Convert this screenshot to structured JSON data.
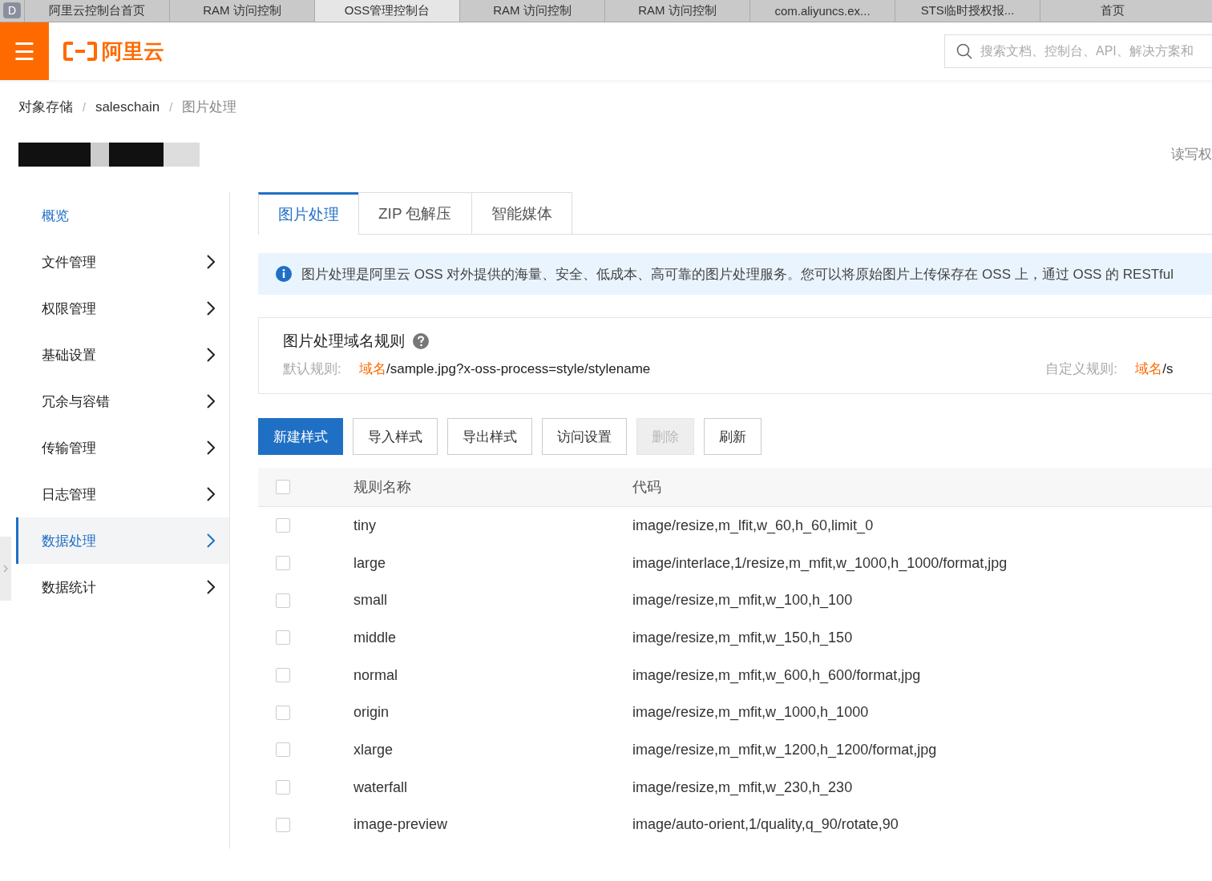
{
  "browser_tabs": [
    {
      "label": "阿里云控制台首页",
      "selected": false
    },
    {
      "label": "RAM 访问控制",
      "selected": false
    },
    {
      "label": "OSS管理控制台",
      "selected": true
    },
    {
      "label": "RAM 访问控制",
      "selected": false
    },
    {
      "label": "RAM 访问控制",
      "selected": false
    },
    {
      "label": "com.aliyuncs.ex...",
      "selected": false
    },
    {
      "label": "STS临时授权报...",
      "selected": false
    },
    {
      "label": "首页",
      "selected": false
    }
  ],
  "browser_badge": "D",
  "header": {
    "menu_icon": "☰",
    "logo_text": "阿里云",
    "search": {
      "placeholder": "搜索文档、控制台、API、解决方案和"
    }
  },
  "breadcrumbs": [
    "对象存储",
    "saleschain",
    "图片处理"
  ],
  "breadcrumb_separator": "/",
  "bucket_meta": "读写权",
  "sidebar": {
    "items": [
      {
        "label": "概览",
        "kind": "link",
        "selected": false
      },
      {
        "label": "文件管理",
        "kind": "group",
        "selected": false
      },
      {
        "label": "权限管理",
        "kind": "group",
        "selected": false
      },
      {
        "label": "基础设置",
        "kind": "group",
        "selected": false
      },
      {
        "label": "冗余与容错",
        "kind": "group",
        "selected": false
      },
      {
        "label": "传输管理",
        "kind": "group",
        "selected": false
      },
      {
        "label": "日志管理",
        "kind": "group",
        "selected": false
      },
      {
        "label": "数据处理",
        "kind": "group",
        "selected": true
      },
      {
        "label": "数据统计",
        "kind": "group",
        "selected": false
      }
    ]
  },
  "tabs": [
    {
      "label": "图片处理",
      "selected": true
    },
    {
      "label": "ZIP 包解压",
      "selected": false
    },
    {
      "label": "智能媒体",
      "selected": false
    }
  ],
  "info": "图片处理是阿里云 OSS 对外提供的海量、安全、低成本、高可靠的图片处理服务。您可以将原始图片上传保存在 OSS 上，通过 OSS 的 RESTful",
  "rules": {
    "title": "图片处理域名规则",
    "default_label": "默认规则:",
    "default_domain": "域名",
    "default_path": "/sample.jpg?x-oss-process=style/stylename",
    "custom_label": "自定义规则:",
    "custom_domain": "域名",
    "custom_path": "/s"
  },
  "buttons": [
    {
      "label": "新建样式",
      "primary": true,
      "disabled": false
    },
    {
      "label": "导入样式",
      "primary": false,
      "disabled": false
    },
    {
      "label": "导出样式",
      "primary": false,
      "disabled": false
    },
    {
      "label": "访问设置",
      "primary": false,
      "disabled": false
    },
    {
      "label": "删除",
      "primary": false,
      "disabled": true
    },
    {
      "label": "刷新",
      "primary": false,
      "disabled": false
    }
  ],
  "table": {
    "columns": [
      "规则名称",
      "代码"
    ],
    "header_checked": false,
    "rows": [
      {
        "name": "tiny",
        "code": "image/resize,m_lfit,w_60,h_60,limit_0",
        "checked": false
      },
      {
        "name": "large",
        "code": "image/interlace,1/resize,m_mfit,w_1000,h_1000/format,jpg",
        "checked": false
      },
      {
        "name": "small",
        "code": "image/resize,m_mfit,w_100,h_100",
        "checked": false
      },
      {
        "name": "middle",
        "code": "image/resize,m_mfit,w_150,h_150",
        "checked": false
      },
      {
        "name": "normal",
        "code": "image/resize,m_mfit,w_600,h_600/format,jpg",
        "checked": false
      },
      {
        "name": "origin",
        "code": "image/resize,m_mfit,w_1000,h_1000",
        "checked": false
      },
      {
        "name": "xlarge",
        "code": "image/resize,m_mfit,w_1200,h_1200/format,jpg",
        "checked": false
      },
      {
        "name": "waterfall",
        "code": "image/resize,m_mfit,w_230,h_230",
        "checked": false
      },
      {
        "name": "image-preview",
        "code": "image/auto-orient,1/quality,q_90/rotate,90",
        "checked": false
      }
    ]
  }
}
